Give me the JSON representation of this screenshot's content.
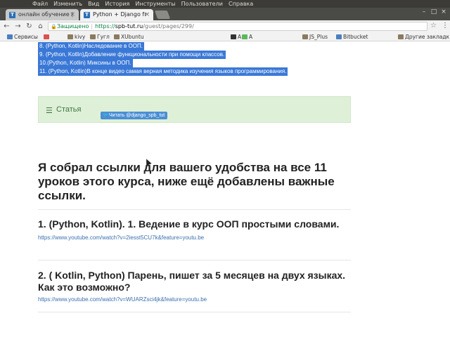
{
  "os_menu": [
    "Файл",
    "Изменить",
    "Вид",
    "История",
    "Инструменты",
    "Пользователи",
    "Справка"
  ],
  "tabs": [
    {
      "title": "онлайн обучение (",
      "favicon": "T",
      "active": false
    },
    {
      "title": "Python + Django fr",
      "favicon": "T",
      "active": true
    }
  ],
  "address_bar": {
    "secure_label": "Защищено",
    "protocol": "https://",
    "host": "spb-tut.ru",
    "path": "/guest/pages/299/"
  },
  "bookmarks": [
    {
      "label": "Сервисы",
      "icon": "apps-icon"
    },
    {
      "label": "",
      "icon": "bookmark-icon"
    },
    {
      "label": "kivy",
      "icon": "folder-icon"
    },
    {
      "label": "Гугл",
      "icon": "folder-icon"
    },
    {
      "label": "XUbuntu",
      "icon": "folder-icon"
    },
    {
      "label": "A",
      "icon": "bookmark-icon"
    },
    {
      "label": "A",
      "icon": "bookmark-icon"
    },
    {
      "label": "JS_Plus",
      "icon": "folder-icon"
    },
    {
      "label": "Bitbucket",
      "icon": "bitbucket-icon"
    },
    {
      "label": "Другие закладк",
      "icon": "folder-icon"
    }
  ],
  "selected_lines": [
    "8. (Python, Kotlin)Наследование в ООП.",
    "9. (Python, Kotlin)Добавление функциональности при помощи классов.",
    "10.(Python, Kotlin) Миксины в ООП.",
    "11. (Python, Kotlin)В конце видео самая верная методика изучения языков программирования."
  ],
  "article_box": {
    "label": "Статья",
    "tweet_label": "Читать @django_spb_tut"
  },
  "intro_heading": "Я собрал ссылки для вашего удобства на все 11 уроков этого курса, ниже ещё добавлены важные ссылки.",
  "items": [
    {
      "title": "1. (Python, Kotlin). 1. Ведение в курс ООП простыми словами.",
      "link": "https://www.youtube.com/watch?v=2iesst5CU7k&feature=youtu.be"
    },
    {
      "title": "2. ( Kotlin, Python) Парень, пишет за 5 месяцев на двух языках. Как это возможно?",
      "link": "https://www.youtube.com/watch?v=WUARZsci4jk&feature=youtu.be"
    }
  ],
  "colors": {
    "selection": "#3a78d6",
    "article_bg": "#dff0d8",
    "article_text": "#3c763d",
    "link": "#3a6fb0"
  }
}
